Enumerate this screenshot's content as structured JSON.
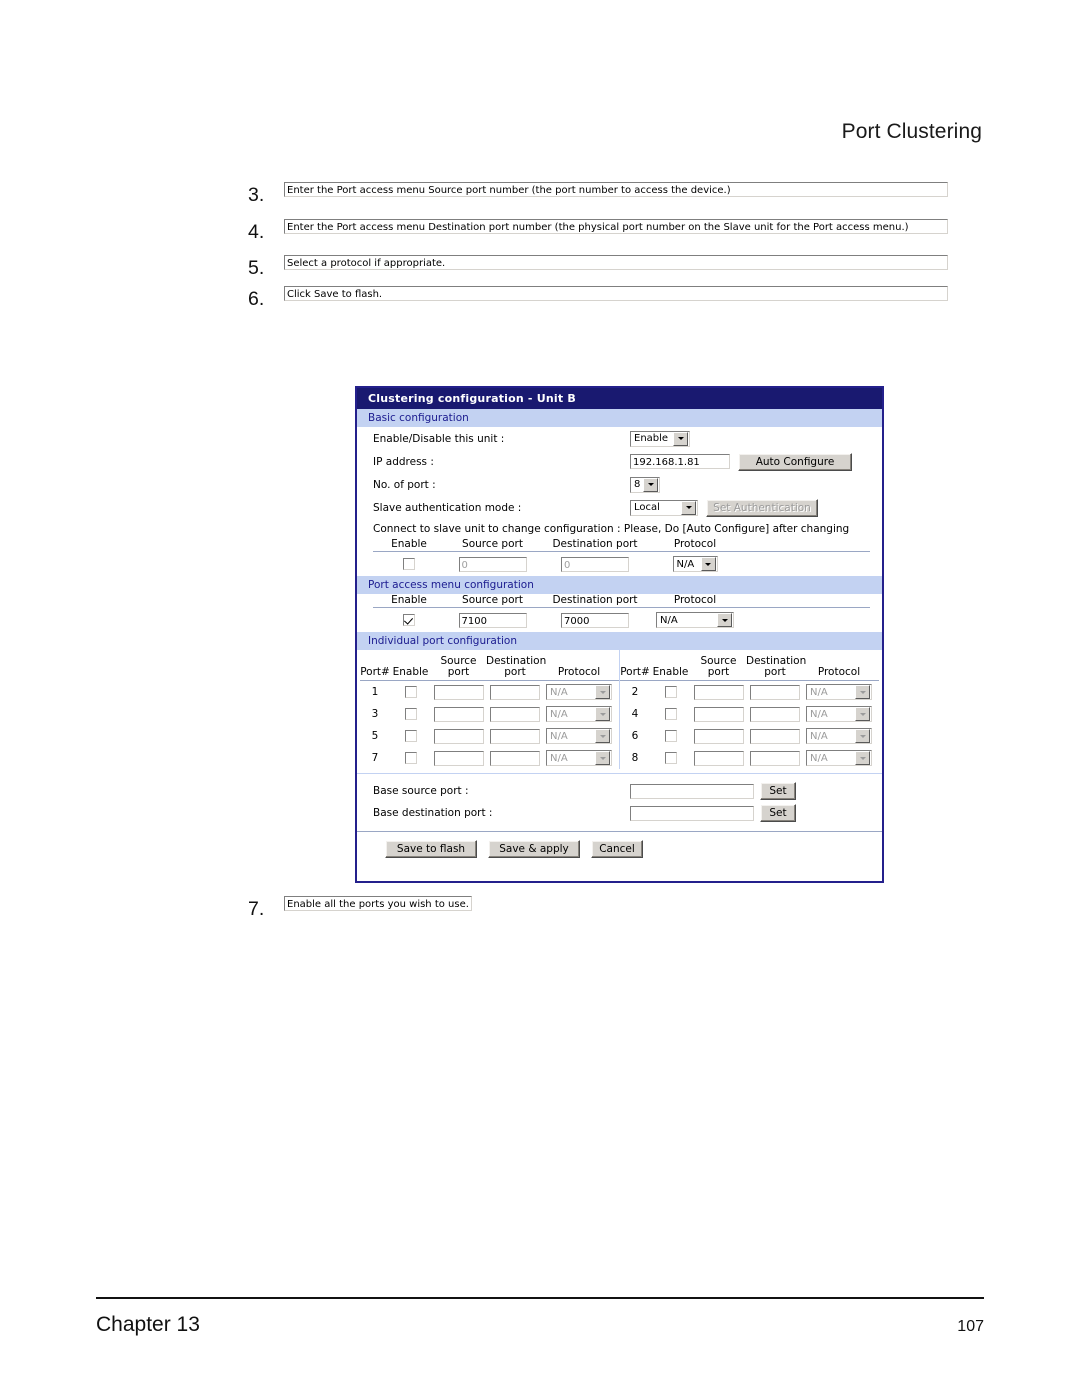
{
  "document": {
    "running_head": "Port Clustering",
    "steps": [
      {
        "num": "3.",
        "text": "Enter the Port access menu Source port number (the port number to access the device.)"
      },
      {
        "num": "4.",
        "text": "Enter the Port access menu Destination port number (the physical port number on the Slave unit for the Port access menu.)"
      },
      {
        "num": "5.",
        "text": "Select a protocol if appropriate."
      },
      {
        "num": "6.",
        "text": "Click Save to flash."
      }
    ],
    "step_after": {
      "num": "7.",
      "text": "Enable all the ports you wish to use."
    },
    "footer": {
      "left": "Chapter 13",
      "page": "107"
    }
  },
  "panel": {
    "title": "Clustering configuration - Unit B",
    "colors": {
      "title_bar": "#191970",
      "section_bar": "#c3d2f2",
      "section_text": "#1b1b8f",
      "border": "#24208c"
    },
    "basic": {
      "section_label": "Basic configuration",
      "enable_label": "Enable/Disable this unit :",
      "enable_value": "Enable",
      "ip_label": "IP address :",
      "ip_value": "192.168.1.81",
      "auto_configure_label": "Auto Configure",
      "ports_label": "No. of port :",
      "ports_value": "8",
      "auth_label": "Slave authentication mode :",
      "auth_value": "Local",
      "set_auth_label": "Set Authentication",
      "set_auth_disabled": true,
      "note": "Connect to slave unit to change configuration : Please, Do [Auto Configure] after changing",
      "headers": {
        "enable": "Enable",
        "source": "Source port",
        "destination": "Destination port",
        "protocol": "Protocol"
      },
      "row": {
        "enabled": false,
        "source_port": "0",
        "destination_port": "0",
        "protocol": "N/A",
        "dim": true
      }
    },
    "port_access": {
      "section_label": "Port access menu configuration",
      "headers": {
        "enable": "Enable",
        "source": "Source port",
        "destination": "Destination port",
        "protocol": "Protocol"
      },
      "row": {
        "enabled": true,
        "source_port": "7100",
        "destination_port": "7000",
        "protocol": "N/A"
      }
    },
    "individual": {
      "section_label": "Individual port configuration",
      "headers": {
        "port_num": "Port#",
        "enable": "Enable",
        "source_l1": "Source",
        "source_l2": "port",
        "destination_l1": "Destination",
        "destination_l2": "port",
        "protocol": "Protocol"
      },
      "rows_left": [
        {
          "port": "1",
          "enabled": false,
          "source_port": "",
          "destination_port": "",
          "protocol": "N/A"
        },
        {
          "port": "3",
          "enabled": false,
          "source_port": "",
          "destination_port": "",
          "protocol": "N/A"
        },
        {
          "port": "5",
          "enabled": false,
          "source_port": "",
          "destination_port": "",
          "protocol": "N/A"
        },
        {
          "port": "7",
          "enabled": false,
          "source_port": "",
          "destination_port": "",
          "protocol": "N/A"
        }
      ],
      "rows_right": [
        {
          "port": "2",
          "enabled": false,
          "source_port": "",
          "destination_port": "",
          "protocol": "N/A"
        },
        {
          "port": "4",
          "enabled": false,
          "source_port": "",
          "destination_port": "",
          "protocol": "N/A"
        },
        {
          "port": "6",
          "enabled": false,
          "source_port": "",
          "destination_port": "",
          "protocol": "N/A"
        },
        {
          "port": "8",
          "enabled": false,
          "source_port": "",
          "destination_port": "",
          "protocol": "N/A"
        }
      ]
    },
    "base": {
      "source_label": "Base source port :",
      "source_value": "",
      "destination_label": "Base destination port :",
      "destination_value": "",
      "set_label": "Set"
    },
    "actions": {
      "save_to_flash": "Save to flash",
      "save_and_apply": "Save & apply",
      "cancel": "Cancel"
    }
  }
}
